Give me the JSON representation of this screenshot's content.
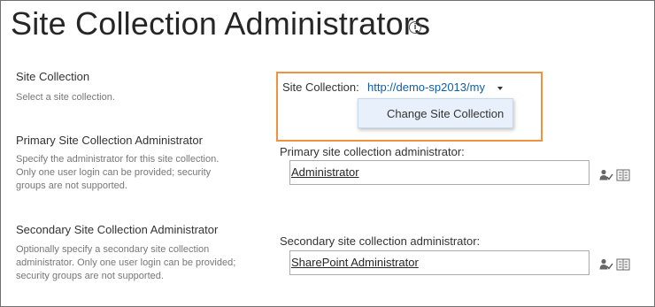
{
  "page": {
    "title": "Site Collection Administrators",
    "info_icon": "info-icon"
  },
  "sections": {
    "site_collection": {
      "title": "Site Collection",
      "description": "Select a site collection.",
      "field_label": "Site Collection:",
      "selected_url": "http://demo-sp2013/my",
      "dropdown_item": "Change Site Collection"
    },
    "primary": {
      "title": "Primary Site Collection Administrator",
      "description_lines": [
        "Specify the administrator for this site collection.",
        "Only one user login can be provided; security",
        "groups are not supported."
      ],
      "field_label": "Primary site collection administrator:",
      "value": "Administrator"
    },
    "secondary": {
      "title": "Secondary Site Collection Administrator",
      "description_lines": [
        "Optionally specify a secondary site collection",
        "administrator. Only one user login can be provided;",
        "security groups are not supported."
      ],
      "field_label": "Secondary site collection administrator:",
      "value": "SharePoint Administrator"
    }
  },
  "icons": {
    "check_names": "person-check-icon",
    "browse": "address-book-icon"
  },
  "colors": {
    "link": "#0f5ea8",
    "highlight_border": "#f0923e",
    "dropdown_bg": "#e8f1fb"
  }
}
